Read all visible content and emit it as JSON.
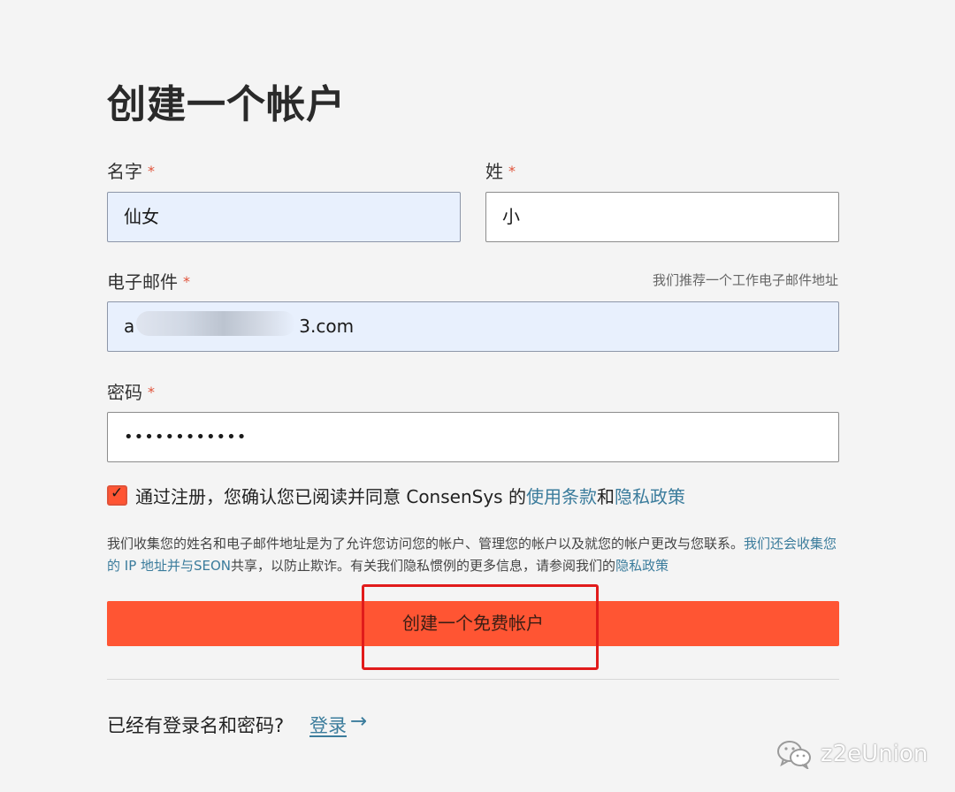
{
  "page": {
    "title": "创建一个帐户"
  },
  "form": {
    "first_name": {
      "label": "名字",
      "required_mark": "*",
      "value": "仙女"
    },
    "last_name": {
      "label": "姓",
      "required_mark": "*",
      "value": "小"
    },
    "email": {
      "label": "电子邮件",
      "required_mark": "*",
      "hint": "我们推荐一个工作电子邮件地址",
      "value_start": "a",
      "value_end": "3.com",
      "note": "partially redacted in screenshot"
    },
    "password": {
      "label": "密码",
      "required_mark": "*",
      "value": "••••••••••••"
    },
    "consent": {
      "checked": true,
      "text_prefix": "通过注册，您确认您已阅读并同意 ConsenSys 的",
      "terms_link": "使用条款",
      "joiner": "和",
      "privacy_link": "隐私政策"
    },
    "privacy_note": {
      "text": "我们收集您的姓名和电子邮件地址是为了允许您访问您的帐户、管理您的帐户以及就您的帐户更改与您联系。",
      "link_text": "我们还会收集您的 IP 地址并与SEON",
      "text_after": "共享，以防止欺诈。有关我们隐私惯例的更多信息，请参阅我们的",
      "policy_link": "隐私政策"
    },
    "submit_label": "创建一个免费帐户"
  },
  "footer": {
    "signin_prompt": "已经有登录名和密码?",
    "signin_link": "登录",
    "arrow": "→"
  },
  "watermark": {
    "text": "z2eUnion",
    "icon": "wechat-icon"
  },
  "colors": {
    "accent": "#ff5533",
    "link": "#3b7c9c",
    "required": "#e0533a",
    "autofill_bg": "#e8f0fd",
    "annotation": "#e11b1b"
  }
}
